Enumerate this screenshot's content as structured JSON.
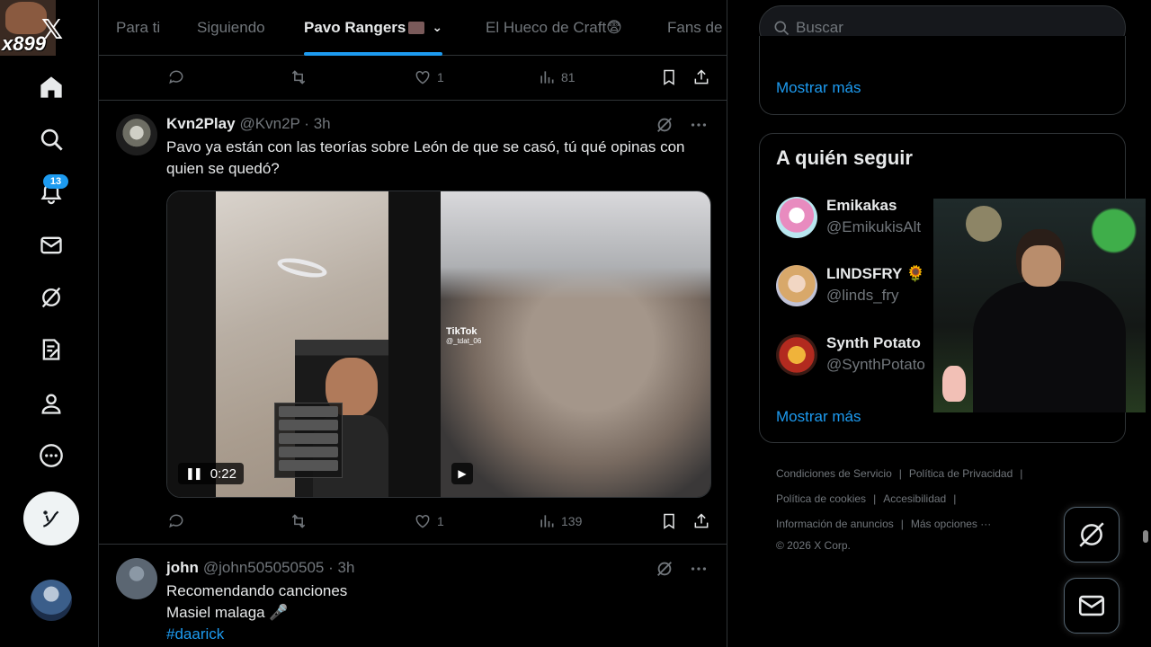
{
  "overlay": {
    "text": "x899"
  },
  "nav": {
    "notifications_count": "13",
    "icons": [
      "x-logo-icon",
      "home-icon",
      "search-icon",
      "bell-icon",
      "mail-icon",
      "grok-icon",
      "notes-icon",
      "profile-icon",
      "more-icon",
      "compose-icon"
    ]
  },
  "tabs": [
    {
      "label": "Para ti"
    },
    {
      "label": "Siguiendo"
    },
    {
      "label": "Pavo Rangers",
      "active": true
    },
    {
      "label": "El Hueco de Craft😨"
    },
    {
      "label": "Fans de"
    }
  ],
  "posts": [
    {
      "actions": {
        "replies": "",
        "reposts": "",
        "likes": "1",
        "views": "81"
      }
    },
    {
      "name": "Kvn2Play",
      "handle": "@Kvn2P · 3h",
      "text_line1": "Pavo ya están con las teorías sobre León de que se casó, tú qué opinas con",
      "text_line2": "quien se quedó?",
      "media": {
        "video_time": "0:22",
        "tiktok_label": "TikTok",
        "tiktok_user": "@_tdat_06"
      },
      "actions": {
        "replies": "",
        "reposts": "",
        "likes": "1",
        "views": "139"
      }
    },
    {
      "name": "john",
      "handle": "@john505050505 · 3h",
      "text_line1": "Recomendando canciones",
      "text_line2": "Masiel malaga 🎤",
      "hashtag": "#daarick"
    }
  ],
  "search": {
    "placeholder": "Buscar"
  },
  "trends_card": {
    "more_label": "Mostrar más"
  },
  "who_to_follow": {
    "title": "A quién seguir",
    "accounts": [
      {
        "name": "Emikakas",
        "handle": "@EmikukisAlt"
      },
      {
        "name": "LINDSFRY 🌻",
        "handle": "@linds_fry"
      },
      {
        "name": "Synth Potato",
        "handle": "@SynthPotato"
      }
    ],
    "more_label": "Mostrar más"
  },
  "footer": {
    "links_row1": [
      "Condiciones de Servicio",
      "Política de Privacidad"
    ],
    "links_row2": [
      "Política de cookies",
      "Accesibilidad"
    ],
    "links_row3": [
      "Información de anuncios",
      "Más opciones ···"
    ],
    "copyright": "© 2026 X Corp."
  },
  "colors": {
    "accent": "#1d9bf0",
    "background": "#000000",
    "border": "#2f3336",
    "muted": "#71767b"
  }
}
